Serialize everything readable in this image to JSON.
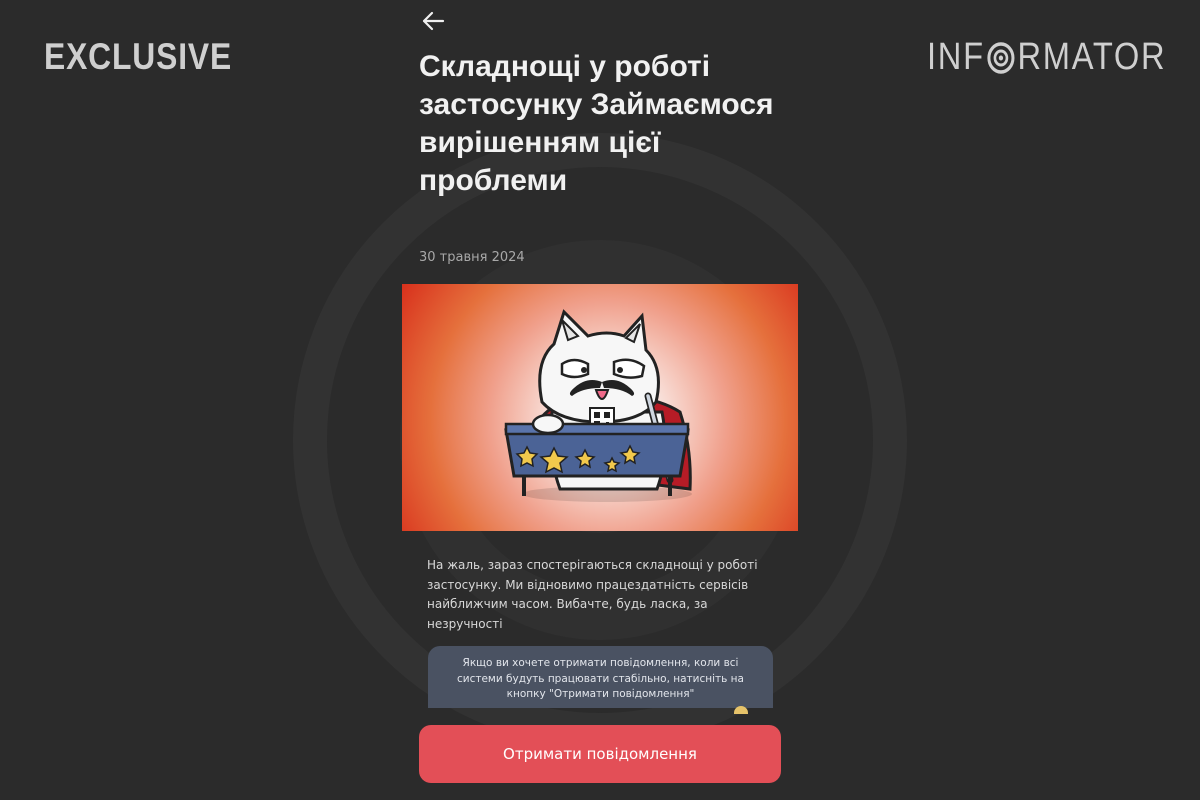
{
  "watermark": {
    "left": "EXCLUSIVE",
    "right_prefix": "INF",
    "right_suffix": "RMATOR"
  },
  "header": {
    "back_icon": "arrow-left-icon"
  },
  "article": {
    "title": "Складнощі у роботі застосунку Займаємося вирішенням цієї проблеми",
    "date": "30 травня 2024",
    "image": "cat-mascot-illustration",
    "body": "На жаль, зараз спостерігаються складнощі у роботі застосунку. Ми відновимо працездатність сервісів найближчим часом. Вибачте, будь ласка, за незручності"
  },
  "notice": {
    "text": "Якщо ви хочете отримати повідомлення, коли всі системи будуть працювати стабільно, натисніть на кнопку \"Отримати повідомлення\""
  },
  "cta": {
    "label": "Отримати повідомлення"
  },
  "colors": {
    "background": "#2b2b2b",
    "accent": "#e34f57",
    "notice_bg": "#4a5262"
  }
}
